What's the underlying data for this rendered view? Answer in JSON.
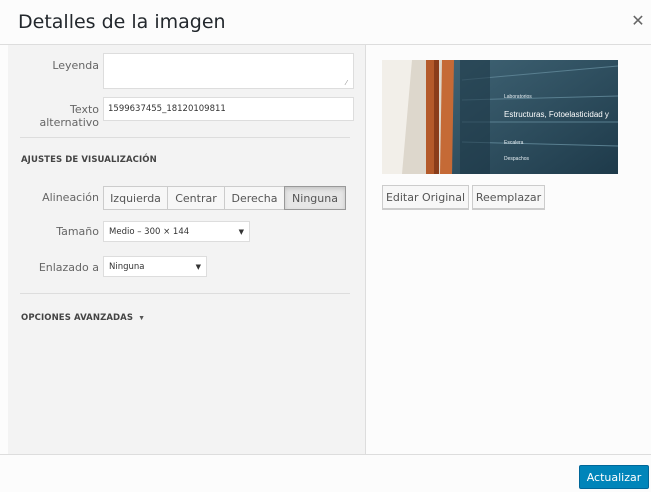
{
  "dialog": {
    "title": "Detalles de la imagen",
    "close_icon": "close-icon"
  },
  "fields": {
    "caption_label": "Leyenda",
    "caption_value": "",
    "alt_label": "Texto alternativo",
    "alt_value": "1599637455_18120109811"
  },
  "display_settings": {
    "heading": "AJUSTES DE VISUALIZACIÓN",
    "alignment_label": "Alineación",
    "alignment_options": [
      "Izquierda",
      "Centrar",
      "Derecha",
      "Ninguna"
    ],
    "alignment_selected": "Ninguna",
    "size_label": "Tamaño",
    "size_value": "Medio – 300 × 144",
    "link_label": "Enlazado a",
    "link_value": "Ninguna"
  },
  "advanced": {
    "heading": "OPCIONES AVANZADAS",
    "toggle_icon": "triangle-down-icon"
  },
  "image_panel": {
    "edit_button": "Editar Original",
    "replace_button": "Reemplazar",
    "sign_text_main": "Laboratorios",
    "sign_text_line": "Estructuras, Fotoelasticidad y",
    "sign_text_3": "Escalera",
    "sign_text_4": "Despachos"
  },
  "footer": {
    "update_button": "Actualizar"
  },
  "colors": {
    "primary": "#0085ba",
    "panel_bg": "#f3f3f3",
    "border": "#dddddd"
  }
}
